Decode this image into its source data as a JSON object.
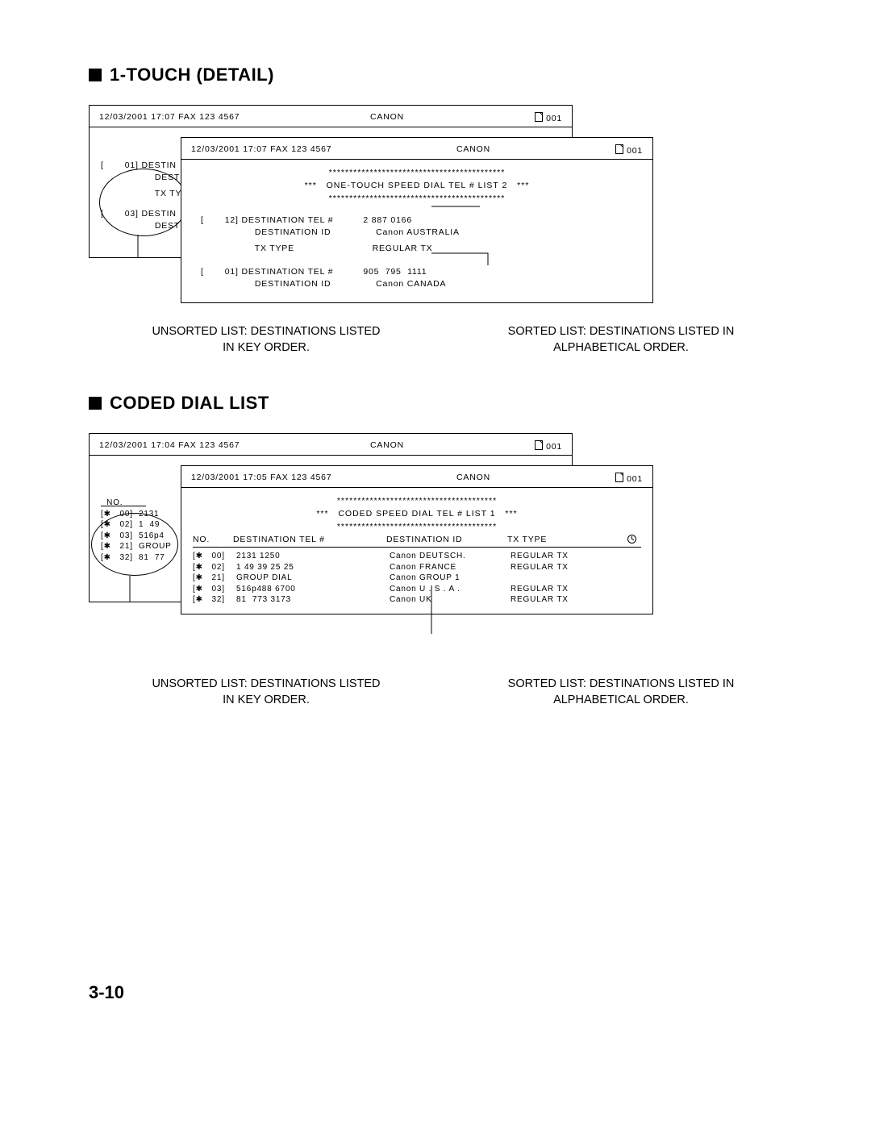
{
  "section1": {
    "title": "1-TOUCH (DETAIL)",
    "back": {
      "datetime": "12/03/2001  17:07  FAX 123 4567",
      "center": "CANON",
      "page": "001",
      "entries": [
        {
          "key": "[       01]",
          "l1": "DESTIN",
          "l2": "DESTIN",
          "l3": "TX TYPE"
        },
        {
          "key": "[       03]",
          "l1": "DESTIN",
          "l2": "DESTIN"
        }
      ]
    },
    "front": {
      "datetime": "12/03/2001  17:07  FAX 123 4567",
      "center": "CANON",
      "page": "001",
      "banner": "ONE-TOUCH SPEED DIAL TEL # LIST 2",
      "entries": [
        {
          "key": "[       12]",
          "tel_label": "DESTINATION TEL #",
          "tel": "2 887 0166",
          "id_label": "DESTINATION ID",
          "id": "Canon AUSTRALIA",
          "tx_label": "TX TYPE",
          "tx": "REGULAR TX"
        },
        {
          "key": "[       01]",
          "tel_label": "DESTINATION TEL #",
          "tel": "905  795  1111",
          "id_label": "DESTINATION ID",
          "id": "Canon CANADA"
        }
      ]
    },
    "caption_left": "UNSORTED LIST: DESTINATIONS LISTED\nIN KEY ORDER.",
    "caption_right": "SORTED LIST: DESTINATIONS LISTED IN\nALPHABETICAL ORDER."
  },
  "section2": {
    "title": "CODED DIAL LIST",
    "back": {
      "datetime": "12/03/2001  17:04  FAX 123 4567",
      "center": "CANON",
      "page": "001",
      "col_no": "NO.",
      "rows": [
        {
          "no": "[✱   00]",
          "v": "2131"
        },
        {
          "no": "[✱   02]",
          "v": "1  49"
        },
        {
          "no": "[✱   03]",
          "v": "516p4"
        },
        {
          "no": "[✱   21]",
          "v": "GROUP"
        },
        {
          "no": "[✱   32]",
          "v": "81  77"
        }
      ]
    },
    "front": {
      "datetime": "12/03/2001  17:05  FAX 123 4567",
      "center": "CANON",
      "page": "001",
      "banner": "CODED SPEED DIAL TEL # LIST 1",
      "headers": {
        "no": "NO.",
        "tel": "DESTINATION TEL #",
        "id": "DESTINATION ID",
        "tx": "TX TYPE"
      },
      "rows": [
        {
          "no": "[✱   00]",
          "tel": "2131 1250",
          "id": "Canon DEUTSCH.",
          "tx": "REGULAR TX"
        },
        {
          "no": "[✱   02]",
          "tel": "1 49 39 25 25",
          "id": "Canon FRANCE",
          "tx": "REGULAR TX"
        },
        {
          "no": "[✱   21]",
          "tel": "GROUP DIAL",
          "id": "Canon GROUP 1",
          "tx": ""
        },
        {
          "no": "[✱   03]",
          "tel": "516p488 6700",
          "id": "Canon U . S . A .",
          "tx": "REGULAR TX"
        },
        {
          "no": "[✱   32]",
          "tel": "81  773 3173",
          "id": "Canon UK",
          "tx": "REGULAR TX"
        }
      ]
    },
    "caption_left": "UNSORTED LIST: DESTINATIONS LISTED\nIN KEY ORDER.",
    "caption_right": "SORTED LIST: DESTINATIONS LISTED IN\nALPHABETICAL ORDER."
  },
  "page_number": "3-10",
  "stars_line": "*******************************************",
  "stars_line2": "***************************************"
}
